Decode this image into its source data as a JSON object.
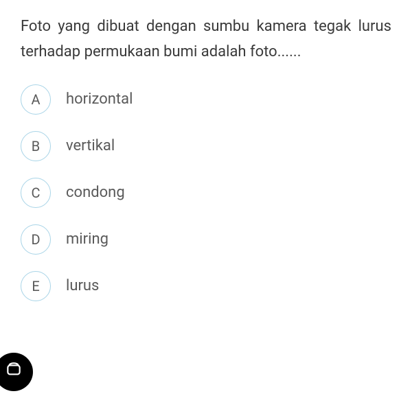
{
  "question": "Foto yang dibuat dengan sumbu kamera tegak lurus terhadap permukaan bumi adalah foto......",
  "options": [
    {
      "letter": "A",
      "text": "horizontal"
    },
    {
      "letter": "B",
      "text": "vertikal"
    },
    {
      "letter": "C",
      "text": "condong"
    },
    {
      "letter": "D",
      "text": "miring"
    },
    {
      "letter": "E",
      "text": "lurus"
    }
  ]
}
